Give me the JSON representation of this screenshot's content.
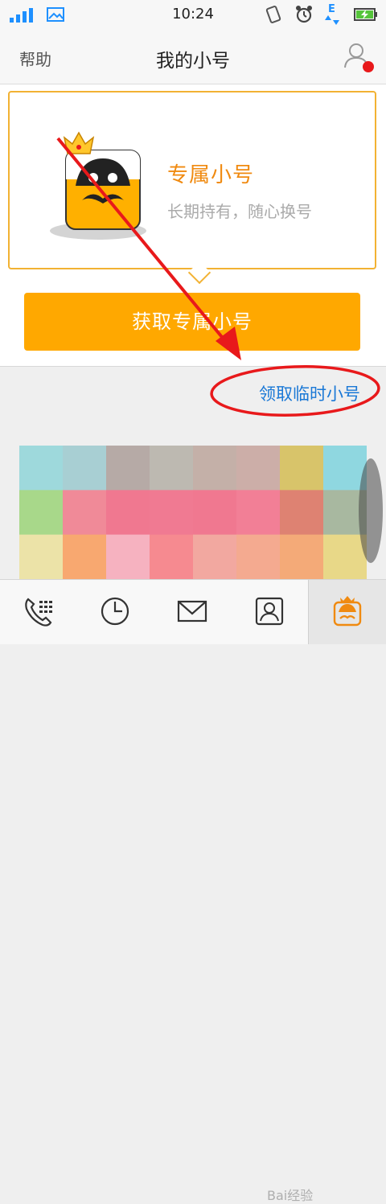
{
  "status_bar": {
    "time": "10:24",
    "network_label": "E"
  },
  "header": {
    "help_label": "帮助",
    "title": "我的小号"
  },
  "card": {
    "title": "专属小号",
    "subtitle": "长期持有，随心换号"
  },
  "actions": {
    "get_button_label": "获取专属小号",
    "temp_link_label": "领取临时小号"
  },
  "tabs": [
    {
      "icon": "phone-dialpad-icon"
    },
    {
      "icon": "clock-icon"
    },
    {
      "icon": "mail-icon"
    },
    {
      "icon": "contact-card-icon"
    },
    {
      "icon": "mascot-tab-icon",
      "active": true
    }
  ],
  "watermark": "Bai经验",
  "colors": {
    "accent": "#ffa800",
    "card_border": "#f2b233",
    "title_orange": "#f08a10",
    "link_blue": "#1a78d6",
    "annotation_red": "#e8191b",
    "notification_dot": "#e8191b"
  },
  "banner_mosaic": [
    [
      "#9ed9dc",
      "#a8cfd3",
      "#b6aaa6",
      "#bdb9b1",
      "#c4b0a8",
      "#ccaea8",
      "#d8c46a",
      "#8fd7e0"
    ],
    [
      "#a8d88a",
      "#f08a98",
      "#f07890",
      "#f07a92",
      "#f07890",
      "#f27f96",
      "#de8272",
      "#a8b8a0"
    ],
    [
      "#ece3a8",
      "#f8a870",
      "#f6b2c0",
      "#f68a90",
      "#f2a8a0",
      "#f4aa90",
      "#f4aa78",
      "#e8d888"
    ]
  ]
}
